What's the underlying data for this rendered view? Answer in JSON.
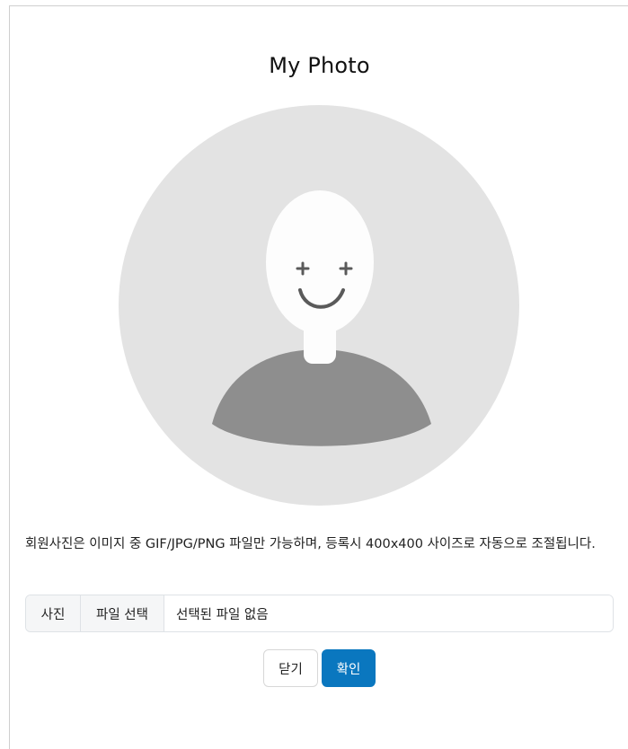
{
  "modal": {
    "title": "My Photo"
  },
  "avatar": {
    "icon": "default-user-avatar",
    "background_color": "#e3e3e3",
    "face_color": "#fdfdfd",
    "body_color": "#8e8e8e"
  },
  "description": "회원사진은 이미지 중 GIF/JPG/PNG 파일만 가능하며, 등록시 400x400 사이즈로 자동으로 조절됩니다.",
  "file_input": {
    "label": "사진",
    "choose_button": "파일 선택",
    "status": "선택된 파일 없음"
  },
  "buttons": {
    "close_label": "닫기",
    "confirm_label": "확인",
    "confirm_color": "#0a77bf"
  }
}
